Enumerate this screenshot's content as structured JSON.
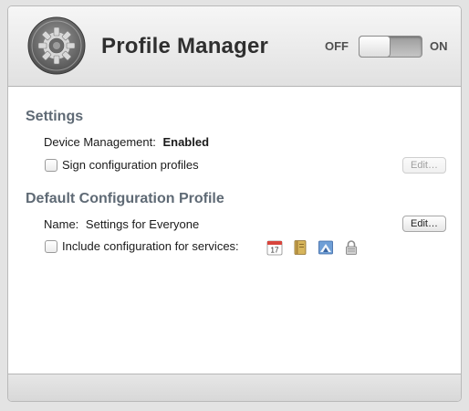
{
  "header": {
    "title": "Profile Manager",
    "switch_off_label": "OFF",
    "switch_on_label": "ON",
    "switch_state": "off"
  },
  "settings": {
    "section_title": "Settings",
    "device_management_label": "Device Management:",
    "device_management_value": "Enabled",
    "sign_profiles_label": "Sign configuration profiles",
    "sign_profiles_checked": false,
    "edit_button": "Edit…"
  },
  "default_profile": {
    "section_title": "Default Configuration Profile",
    "name_label": "Name:",
    "name_value": "Settings for Everyone",
    "edit_button": "Edit…",
    "include_services_label": "Include configuration for services:",
    "include_services_checked": false,
    "service_icons": [
      "calendar-icon",
      "address-book-icon",
      "mail-icon",
      "vpn-lock-icon"
    ],
    "calendar_day": "17"
  },
  "colors": {
    "accent": "#5f6a75",
    "background": "#e3e3e3"
  }
}
